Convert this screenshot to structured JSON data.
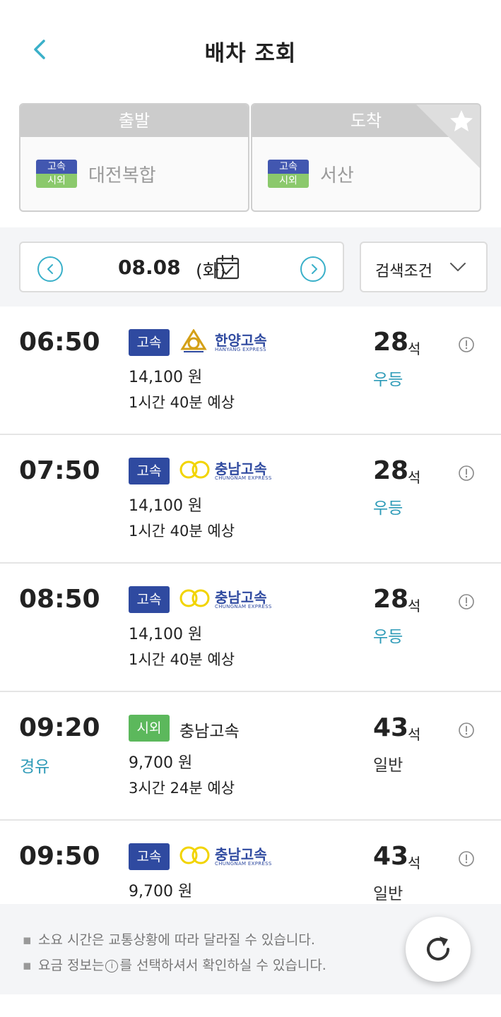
{
  "header": {
    "title": "배차 조회",
    "back_icon": "chevron-left-icon"
  },
  "route": {
    "departure": {
      "label": "출발",
      "type_top": "고속",
      "type_bottom": "시외",
      "terminal": "대전복합"
    },
    "arrival": {
      "label": "도착",
      "type_top": "고속",
      "type_bottom": "시외",
      "terminal": "서산",
      "favorite_icon": "star-icon"
    }
  },
  "date_bar": {
    "date": "08.08",
    "day": "(화)",
    "prev_icon": "chevron-left-circle-icon",
    "next_icon": "chevron-right-circle-icon",
    "calendar_icon": "calendar-icon",
    "filter_label": "검색조건",
    "filter_icon": "chevron-down-icon"
  },
  "buses": [
    {
      "time": "06:50",
      "via": "",
      "badge": "고속",
      "badge_type": "express",
      "company": "한양고속",
      "company_sub": "HANYANG EXPRESS",
      "logo": "hanyang",
      "fare": "14,100 원",
      "duration": "1시간 40분 예상",
      "seats": "28",
      "seat_unit": "석",
      "grade": "우등",
      "grade_type": "premium"
    },
    {
      "time": "07:50",
      "via": "",
      "badge": "고속",
      "badge_type": "express",
      "company": "충남고속",
      "company_sub": "CHUNGNAM EXPRESS",
      "logo": "chungnam",
      "fare": "14,100 원",
      "duration": "1시간 40분 예상",
      "seats": "28",
      "seat_unit": "석",
      "grade": "우등",
      "grade_type": "premium"
    },
    {
      "time": "08:50",
      "via": "",
      "badge": "고속",
      "badge_type": "express",
      "company": "충남고속",
      "company_sub": "CHUNGNAM EXPRESS",
      "logo": "chungnam",
      "fare": "14,100 원",
      "duration": "1시간 40분 예상",
      "seats": "28",
      "seat_unit": "석",
      "grade": "우등",
      "grade_type": "premium"
    },
    {
      "time": "09:20",
      "via": "경유",
      "badge": "시외",
      "badge_type": "intercity",
      "company": "충남고속",
      "company_sub": "",
      "logo": "text",
      "fare": "9,700 원",
      "duration": "3시간 24분 예상",
      "seats": "43",
      "seat_unit": "석",
      "grade": "일반",
      "grade_type": "normal"
    },
    {
      "time": "09:50",
      "via": "",
      "badge": "고속",
      "badge_type": "express",
      "company": "충남고속",
      "company_sub": "CHUNGNAM EXPRESS",
      "logo": "chungnam",
      "fare": "9,700 원",
      "duration": "",
      "seats": "43",
      "seat_unit": "석",
      "grade": "일반",
      "grade_type": "normal"
    }
  ],
  "footer": {
    "bullet": "▪",
    "note1": "소요 시간은 교통상황에 따라 달라질 수 있습니다.",
    "note2_before": "요금 정보는",
    "note2_icon": "i",
    "note2_after": "를 선택하셔서 확인하실 수 있습니다.",
    "refresh_icon": "refresh-icon"
  },
  "colors": {
    "accent": "#2e9bb8",
    "express_badge": "#2f4aa0",
    "intercity_badge": "#5cb85c",
    "logo_gold": "#d4a017",
    "logo_yellow": "#f2d400"
  }
}
